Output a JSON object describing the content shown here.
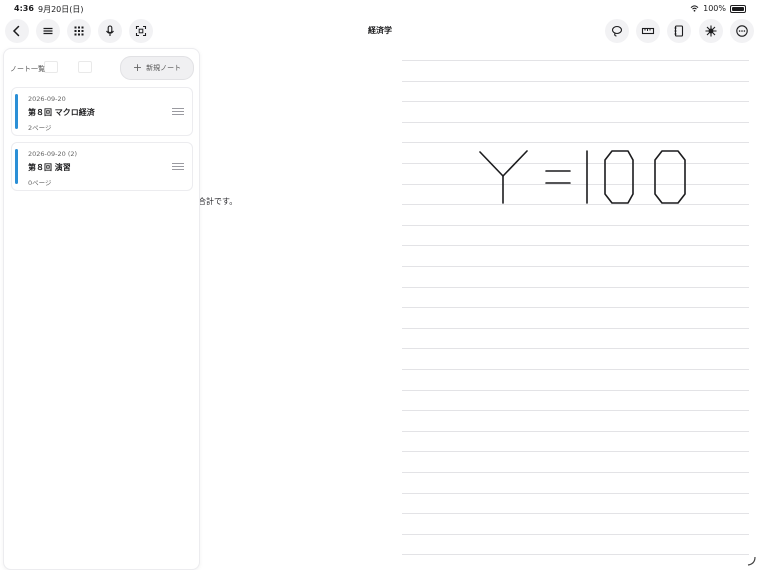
{
  "status": {
    "time": "4:36",
    "date": "9月20日(日)",
    "battery": "100%"
  },
  "toolbar": {
    "title": "経済学",
    "left_icons": [
      "back-icon",
      "menu-icon",
      "grid-icon",
      "mic-icon",
      "scan-icon"
    ],
    "right_icons": [
      "lasso-icon",
      "ruler-icon",
      "notebook-icon",
      "sparkle-icon",
      "more-icon"
    ]
  },
  "sidebar": {
    "title": "ノート一覧",
    "new_note_label": "新規ノート",
    "notes": [
      {
        "date": "2026-09-20",
        "title": "第８回 マクロ経済",
        "pages": "2ページ",
        "accent": "#2b8fd6"
      },
      {
        "date": "2026-09-20 (2)",
        "title": "第８回 演習",
        "pages": "0ページ",
        "accent": "#2b8fd6"
      }
    ]
  },
  "note_body": {
    "visible_text": "合計です。"
  },
  "canvas": {
    "handwriting": "Y =100"
  }
}
